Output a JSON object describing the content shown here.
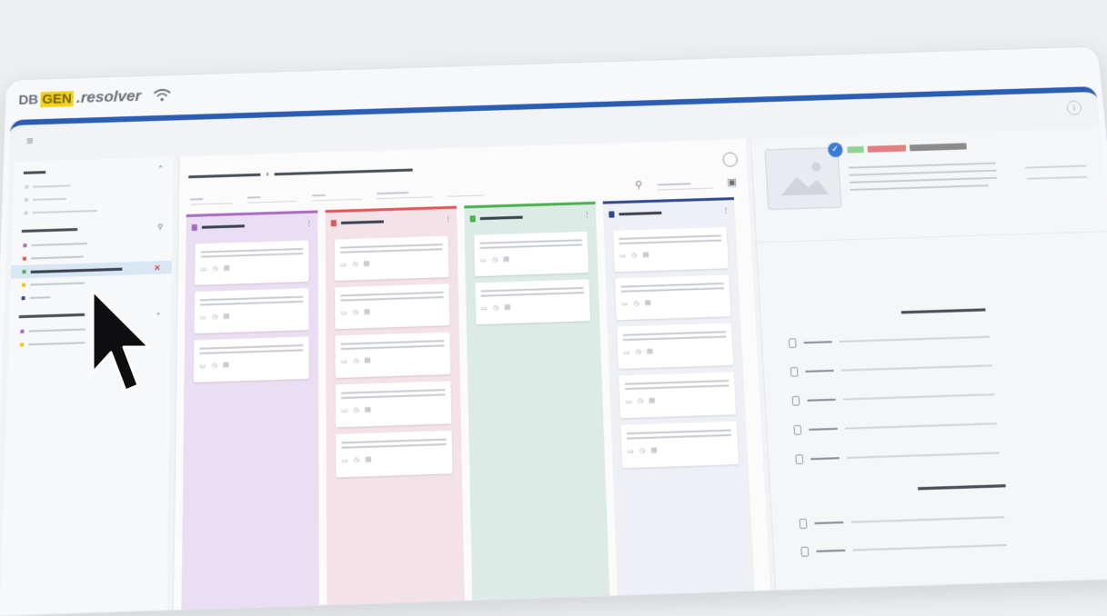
{
  "brand": {
    "prefix": "DB",
    "highlight": "GEN",
    "suffix": ".resolver"
  },
  "topbar": {
    "menu_icon": "hamburger-icon",
    "info_icon": "info-icon",
    "info_glyph": "i"
  },
  "sidebar": {
    "groups": [
      {
        "label": "",
        "items": [
          "",
          "",
          ""
        ]
      },
      {
        "label": "",
        "items": [
          "",
          "",
          "",
          "",
          ""
        ]
      },
      {
        "label": "",
        "items": [
          "",
          ""
        ]
      }
    ]
  },
  "board": {
    "columns": [
      {
        "color": "#a86cc1",
        "bg": "#eadff2",
        "cards": 3
      },
      {
        "color": "#e2575b",
        "bg": "#f3e2e8",
        "cards": 5
      },
      {
        "color": "#4caf50",
        "bg": "#dcebe6",
        "cards": 2
      },
      {
        "color": "#2f4a8f",
        "bg": "#eef0f5",
        "cards": 5
      }
    ]
  },
  "detail": {
    "tags": [
      "#8fd48f",
      "#e27f7f",
      "#8b8b8b"
    ]
  },
  "cursor": {
    "icon": "mouse-pointer-icon"
  }
}
